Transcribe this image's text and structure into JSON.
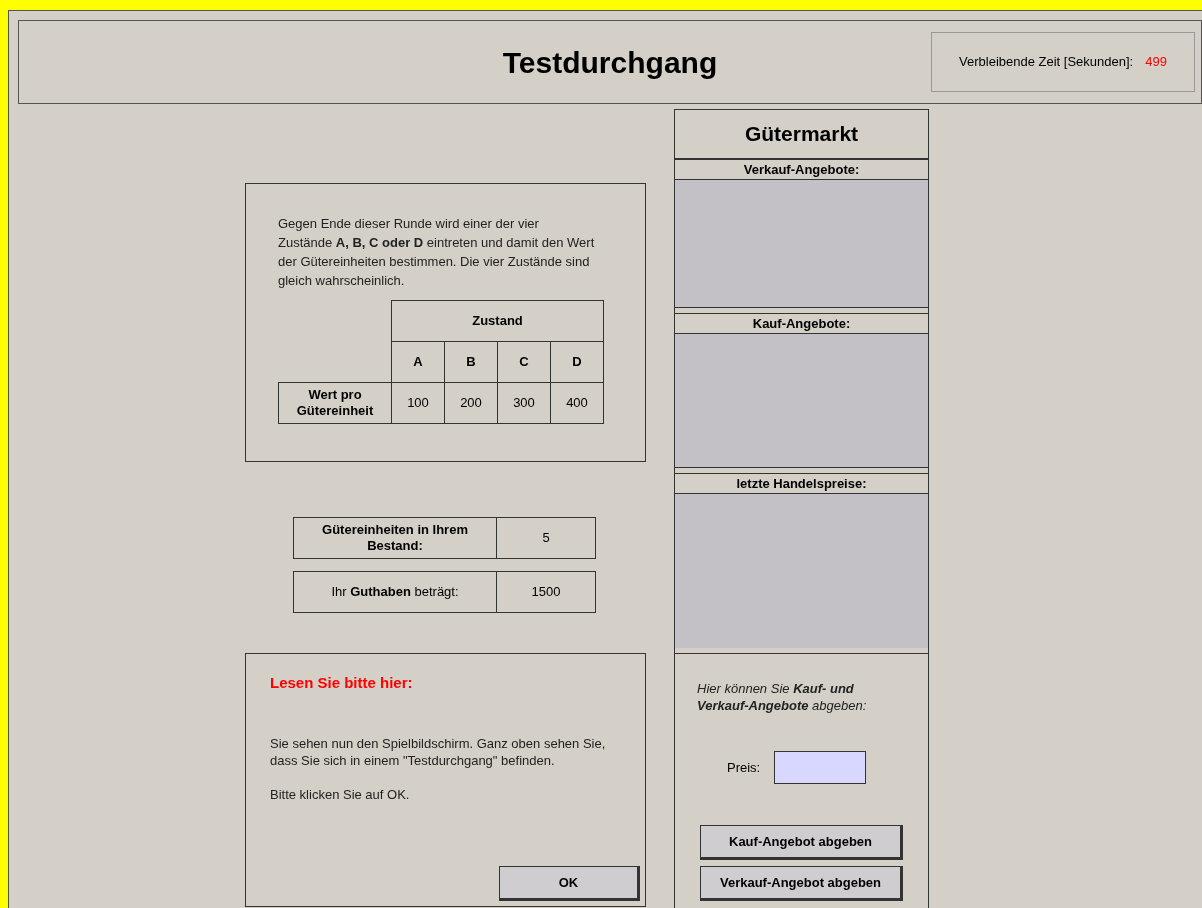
{
  "header": {
    "title": "Testdurchgang",
    "timer_label": "Verbleibende Zeit [Sekunden]:",
    "timer_value": "499"
  },
  "info": {
    "text": "Gegen Ende dieser Runde wird einer der vier Zustände **A, B, C oder D** eintreten und damit den Wert der Gütereinheiten bestimmen. Die vier Zustände sind gleich wahrscheinlich.",
    "table": {
      "group_header": "Zustand",
      "columns": [
        "A",
        "B",
        "C",
        "D"
      ],
      "row_label": "Wert pro Gütereinheit",
      "values": [
        "100",
        "200",
        "300",
        "400"
      ]
    }
  },
  "holdings": [
    {
      "label": "Gütereinheiten in Ihrem Bestand:",
      "value": "5"
    },
    {
      "label": "Ihr **Guthaben** beträgt:",
      "value": "1500"
    }
  ],
  "message": {
    "heading": "Lesen Sie bitte hier:",
    "paragraphs": [
      "Sie sehen nun den Spielbildschirm. Ganz oben sehen Sie, dass Sie sich in einem \"Testdurchgang\" befinden.",
      "Bitte klicken Sie auf OK."
    ],
    "button": "OK"
  },
  "market": {
    "title": "Gütermarkt",
    "lists": [
      {
        "header": "Verkauf-Angebote:"
      },
      {
        "header": "Kauf-Angebote:"
      },
      {
        "header": "letzte Handelspreise:"
      }
    ],
    "form": {
      "instructions": "Hier können Sie **Kauf- und Verkauf-Angebote** abgeben:",
      "price_label": "Preis:",
      "buttons": [
        "Kauf-Angebot abgeben",
        "Verkauf-Angebot abgeben"
      ]
    }
  }
}
